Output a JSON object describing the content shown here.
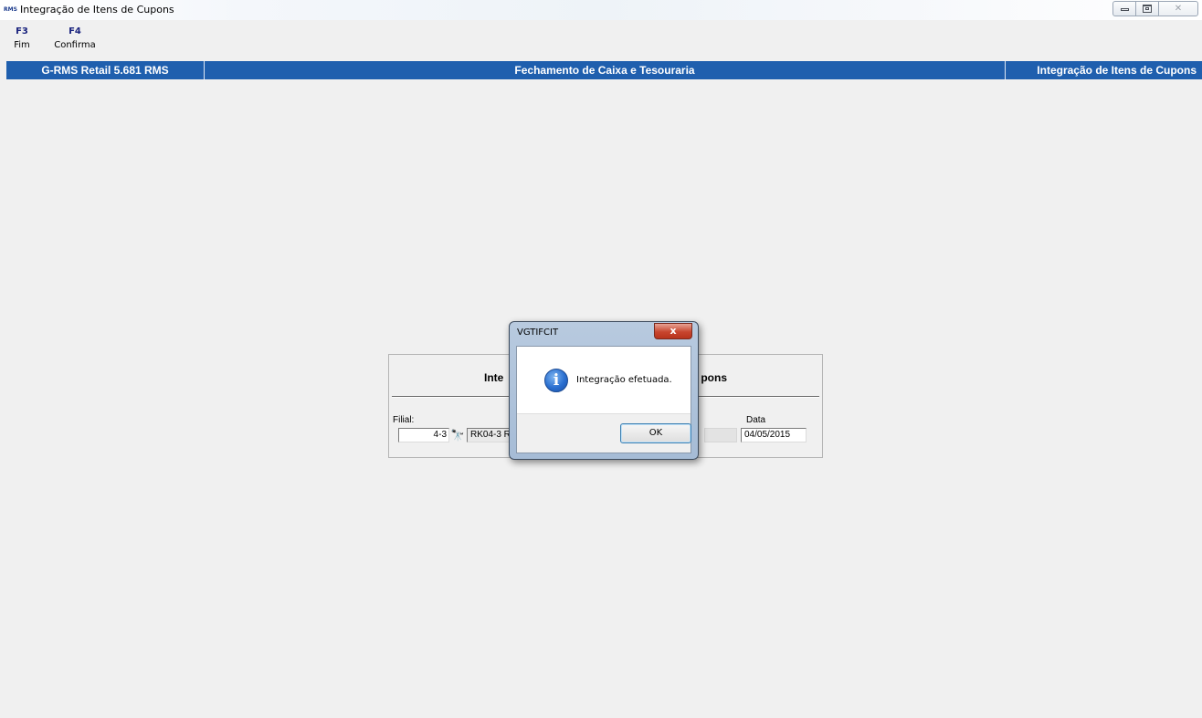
{
  "window": {
    "logo_text": "RMS",
    "title": "Integração de Itens de Cupons"
  },
  "toolbar": {
    "items": [
      {
        "key": "F3",
        "label": "Fim"
      },
      {
        "key": "F4",
        "label": "Confirma"
      }
    ]
  },
  "header": {
    "left": "G-RMS Retail 5.681 RMS",
    "center": "Fechamento de Caixa e Tesouraria",
    "right": "Integração de Itens de Cupons"
  },
  "form": {
    "title_left_visible": "Inte",
    "title_right_visible": "pons",
    "filial_label": "Filial:",
    "filial_code": "4-3",
    "filial_name": "RK04-3 R",
    "data_label": "Data",
    "data_value": "04/05/2015"
  },
  "dialog": {
    "title": "VGTIFCIT",
    "message": "Integração efetuada.",
    "ok_label": "OK",
    "close_glyph": "x"
  }
}
